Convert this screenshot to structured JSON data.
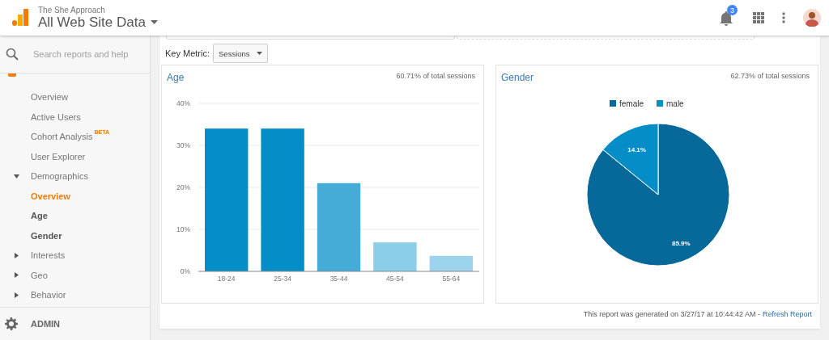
{
  "header": {
    "account": "The She Approach",
    "property": "All Web Site Data",
    "notifications": "3"
  },
  "sidebar": {
    "search": {
      "placeholder": "Search reports and help"
    },
    "items": [
      {
        "kind": "link",
        "label": "Overview",
        "selected": false
      },
      {
        "kind": "link",
        "label": "Active Users",
        "selected": false
      },
      {
        "kind": "link",
        "label": "Cohort Analysis",
        "badge": "BETA",
        "selected": false
      },
      {
        "kind": "link",
        "label": "User Explorer",
        "selected": false
      },
      {
        "kind": "group",
        "label": "Demographics",
        "expanded": true,
        "selected": false,
        "children": [
          {
            "label": "Overview",
            "selected": true
          },
          {
            "label": "Age",
            "selected": false
          },
          {
            "label": "Gender",
            "selected": false
          }
        ]
      },
      {
        "kind": "group",
        "label": "Interests",
        "expanded": false,
        "selected": false
      },
      {
        "kind": "group",
        "label": "Geo",
        "expanded": false,
        "selected": false
      },
      {
        "kind": "group",
        "label": "Behavior",
        "expanded": false,
        "selected": false
      }
    ],
    "admin": "ADMIN"
  },
  "report": {
    "key_metric": {
      "label": "Key Metric:",
      "value": "Sessions"
    },
    "panels": [
      {
        "title": "Age",
        "share": "60.71% of total sessions",
        "chart_data": {
          "type": "bar",
          "categories": [
            "18-24",
            "25-34",
            "35-44",
            "45-54",
            "55-64"
          ],
          "series": [
            {
              "colors": [
                "#058dc7",
                "#058dc7",
                "#45acd8",
                "#8bceea",
                "#9cd4ed"
              ],
              "values": [
                34.0,
                34.0,
                21.0,
                6.9,
                3.7
              ]
            }
          ],
          "grid": true,
          "ylim": [
            0,
            40
          ],
          "yticks": [
            {
              "value": 0,
              "label": "0%"
            },
            {
              "value": 10,
              "label": "10%"
            },
            {
              "value": 20,
              "label": "20%"
            },
            {
              "value": 30,
              "label": "30%"
            },
            {
              "value": 40,
              "label": "40%"
            }
          ]
        }
      },
      {
        "title": "Gender",
        "share": "62.73% of total sessions",
        "chart_data": {
          "type": "pie",
          "categories": [
            "female",
            "male"
          ],
          "series": [
            {
              "colors": [
                "#07689a",
                "#058dc7"
              ],
              "values": [
                85.9,
                14.1
              ]
            }
          ],
          "value_labels": [
            "85.9%",
            "14.1%"
          ],
          "legend": "top"
        }
      }
    ],
    "footer": {
      "text": "This report was generated on 3/27/17 at 10:44:42 AM -",
      "link": "Refresh Report"
    }
  }
}
